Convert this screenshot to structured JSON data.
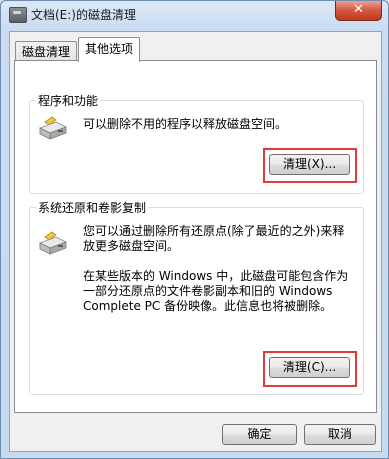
{
  "window": {
    "title": "文档(E:)的磁盘清理",
    "close_label": "✕"
  },
  "tabs": [
    {
      "label": "磁盘清理"
    },
    {
      "label": "其他选项"
    }
  ],
  "programs": {
    "title": "程序和功能",
    "description": "可以删除不用的程序以释放磁盘空间。",
    "button": "清理(X)..."
  },
  "restore": {
    "title": "系统还原和卷影复制",
    "description_line1": "您可以通过删除所有还原点(除了最近的之外)来释",
    "description_line2": "放更多磁盘空间。",
    "note_line1": "在某些版本的 Windows 中，此磁盘可能包含作为",
    "note_line2": "一部分还原点的文件卷影副本和旧的 Windows",
    "note_line3": "Complete PC 备份映像。此信息也将被删除。",
    "button": "清理(C)..."
  },
  "footer": {
    "ok_label": "确定",
    "cancel_label": "取消"
  },
  "highlight_color": "#e03c3c"
}
